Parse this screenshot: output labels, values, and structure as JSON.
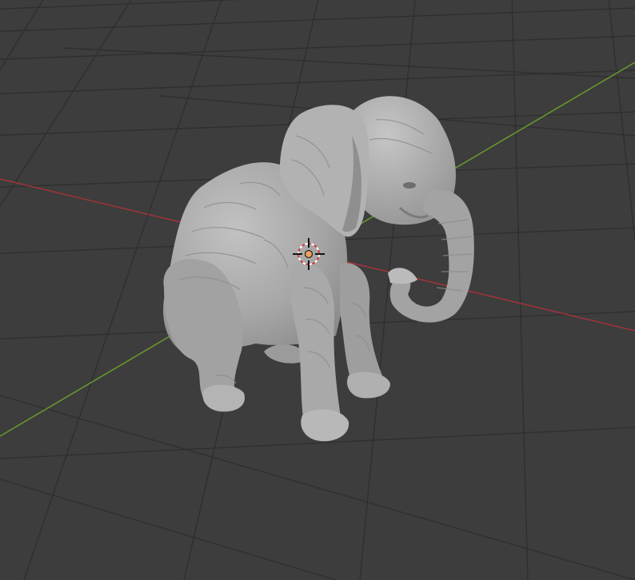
{
  "viewport": {
    "background_color": "#3d3d3d",
    "grid_color": "#2f2f2f",
    "x_axis_color": "#a0333b",
    "y_axis_color": "#6a9a2a"
  },
  "object": {
    "type": "sculpt-mesh",
    "subject": "sitting-elephant",
    "mesh_color": "#a8a8a8"
  },
  "cursor_3d": {
    "icon": "3d-cursor-icon",
    "ring_colors": [
      "#d13b3b",
      "#ffffff"
    ],
    "center_color": "#f0a15a"
  }
}
